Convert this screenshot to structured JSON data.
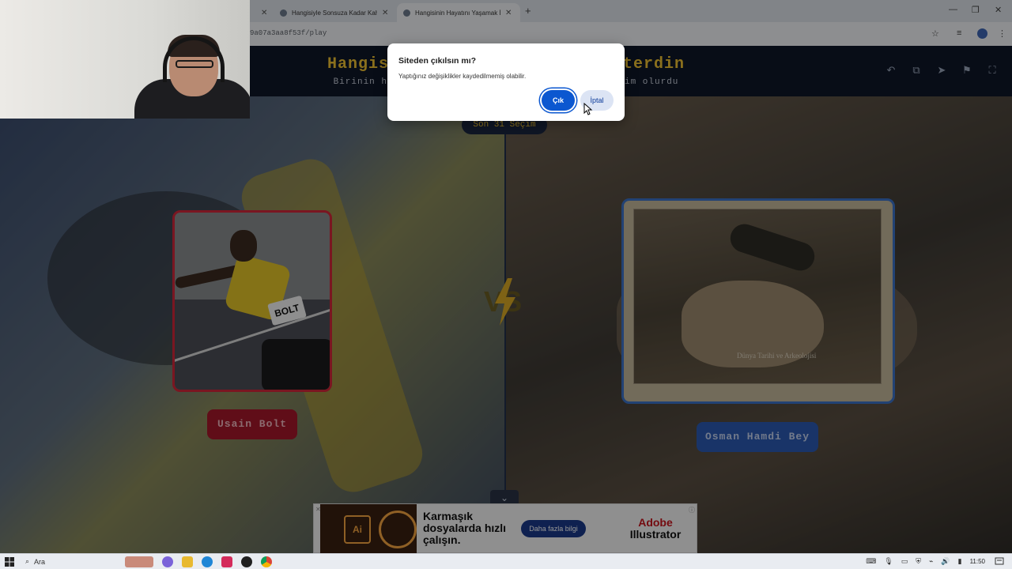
{
  "browser": {
    "tabs": [
      {
        "title": "Hangisiyle Sonsuza Kadar Kah"
      },
      {
        "title": "Hangisinin Hayatını Yaşamak İs"
      }
    ],
    "url": "9a07a3aa8f53f/play"
  },
  "page": {
    "title_left": "Hangis",
    "title_right": "terdin",
    "subtitle_left": "Birinin h",
    "subtitle_right": "im olurdu",
    "badge": "Son 31 Seçim",
    "left_choice": {
      "name": "Usain Bolt",
      "bib": "BOLT",
      "accent": "#d3273a"
    },
    "right_choice": {
      "name": "Osman Hamdi Bey",
      "watermark": "Dünya Tarihi ve Arkeolojisi",
      "accent": "#3b73c8"
    },
    "vs_label": "VS"
  },
  "dialog": {
    "title": "Siteden çıkılsın mı?",
    "message": "Yaptığınız değişiklikler kaydedilmemiş olabilir.",
    "leave_label": "Çık",
    "cancel_label": "İptal"
  },
  "ad": {
    "headline": "Karmaşık dosyalarda hızlı çalışın.",
    "cta": "Daha fazla bilgi",
    "brand_top": "Adobe",
    "brand_bottom": "Illustrator",
    "art_label": "Ai"
  },
  "taskbar": {
    "search_label": "Ara",
    "time": "11:50"
  },
  "colors": {
    "title_gold": "#f0c233",
    "dialog_primary": "#0b57d0"
  }
}
